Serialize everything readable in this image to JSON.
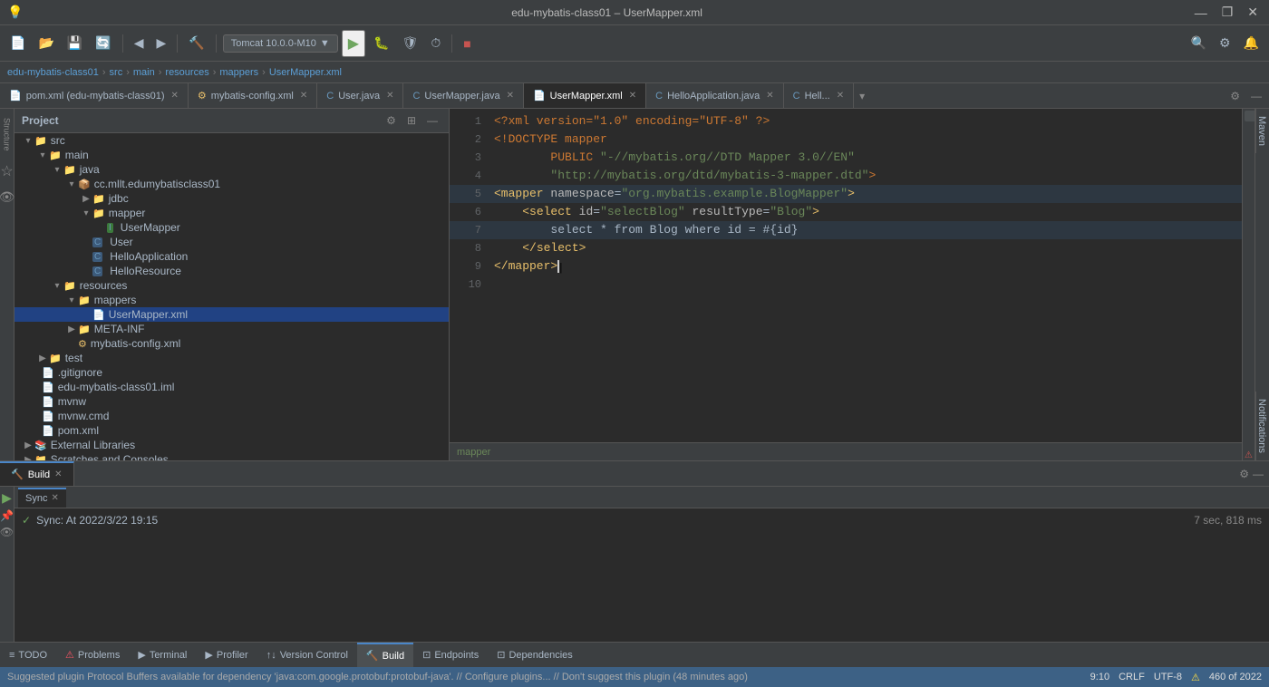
{
  "titleBar": {
    "title": "edu-mybatis-class01 – UserMapper.xml",
    "minimizeBtn": "—",
    "maximizeBtn": "❐",
    "closeBtn": "✕"
  },
  "toolbar": {
    "runConfig": "Tomcat 10.0.0-M10"
  },
  "navBar": {
    "items": [
      "edu-mybatis-class01",
      "src",
      "main",
      "resources",
      "mappers",
      "UserMapper.xml"
    ]
  },
  "tabs": [
    {
      "label": "pom.xml",
      "sublabel": "(edu-mybatis-class01)",
      "active": false,
      "icon": "📄"
    },
    {
      "label": "mybatis-config.xml",
      "active": false,
      "icon": "⚙️"
    },
    {
      "label": "User.java",
      "active": false,
      "icon": "☕"
    },
    {
      "label": "UserMapper.java",
      "active": false,
      "icon": "☕"
    },
    {
      "label": "UserMapper.xml",
      "active": true,
      "icon": "📄"
    },
    {
      "label": "HelloApplication.java",
      "active": false,
      "icon": "☕"
    },
    {
      "label": "Hell...",
      "active": false,
      "icon": "☕"
    }
  ],
  "editor": {
    "lines": [
      {
        "num": 1,
        "content": "<?xml version=\"1.0\" encoding=\"UTF-8\" ?>",
        "type": "decl"
      },
      {
        "num": 2,
        "content": "<!DOCTYPE mapper",
        "type": "doctype"
      },
      {
        "num": 3,
        "content": "        PUBLIC \"-//mybatis.org//DTD Mapper 3.0//EN\"",
        "type": "string"
      },
      {
        "num": 4,
        "content": "        \"http://mybatis.org/dtd/mybatis-3-mapper.dtd\">",
        "type": "string"
      },
      {
        "num": 5,
        "content": "<mapper namespace=\"org.mybatis.example.BlogMapper\">",
        "type": "tag",
        "highlighted": true
      },
      {
        "num": 6,
        "content": "    <select id=\"selectBlog\" resultType=\"Blog\">",
        "type": "tag"
      },
      {
        "num": 7,
        "content": "        select * from Blog where id = #{id}",
        "type": "mixed",
        "cursor": true
      },
      {
        "num": 8,
        "content": "    </select>",
        "type": "tag"
      },
      {
        "num": 9,
        "content": "</mapper>",
        "type": "tag",
        "cursor_end": true
      },
      {
        "num": 10,
        "content": "",
        "type": "empty"
      }
    ],
    "statusTag": "mapper"
  },
  "projectTree": {
    "title": "Project",
    "items": [
      {
        "label": "src",
        "type": "folder",
        "level": 1,
        "expanded": true
      },
      {
        "label": "main",
        "type": "folder",
        "level": 2,
        "expanded": true
      },
      {
        "label": "java",
        "type": "folder",
        "level": 3,
        "expanded": true
      },
      {
        "label": "cc.mllt.edumybatisclass01",
        "type": "package",
        "level": 4,
        "expanded": true
      },
      {
        "label": "jdbc",
        "type": "folder",
        "level": 5,
        "expanded": false
      },
      {
        "label": "mapper",
        "type": "folder",
        "level": 5,
        "expanded": true
      },
      {
        "label": "UserMapper",
        "type": "interface",
        "level": 6
      },
      {
        "label": "User",
        "type": "class",
        "level": 5
      },
      {
        "label": "HelloApplication",
        "type": "class",
        "level": 5
      },
      {
        "label": "HelloResource",
        "type": "class",
        "level": 5
      },
      {
        "label": "resources",
        "type": "folder",
        "level": 3,
        "expanded": true
      },
      {
        "label": "mappers",
        "type": "folder",
        "level": 4,
        "expanded": true
      },
      {
        "label": "UserMapper.xml",
        "type": "xml",
        "level": 5,
        "selected": true
      },
      {
        "label": "META-INF",
        "type": "folder",
        "level": 4,
        "expanded": false
      },
      {
        "label": "mybatis-config.xml",
        "type": "xml",
        "level": 4
      },
      {
        "label": "test",
        "type": "folder",
        "level": 2,
        "expanded": false
      },
      {
        "label": ".gitignore",
        "type": "file",
        "level": 1
      },
      {
        "label": "edu-mybatis-class01.iml",
        "type": "iml",
        "level": 1
      },
      {
        "label": "mvnw",
        "type": "file",
        "level": 1
      },
      {
        "label": "mvnw.cmd",
        "type": "file",
        "level": 1
      },
      {
        "label": "pom.xml",
        "type": "xml",
        "level": 1
      },
      {
        "label": "External Libraries",
        "type": "folder",
        "level": 1,
        "expanded": false
      },
      {
        "label": "Scratches and Consoles",
        "type": "folder",
        "level": 1,
        "expanded": false
      }
    ]
  },
  "bottomPanel": {
    "tabs": [
      {
        "label": "Build",
        "active": true,
        "closeable": true
      },
      {
        "icon": "≡",
        "label": "TODO"
      },
      {
        "icon": "⚠",
        "label": "Problems"
      },
      {
        "icon": "▶",
        "label": "Terminal"
      },
      {
        "icon": "▶",
        "label": "Profiler"
      },
      {
        "icon": "↑↓",
        "label": "Version Control"
      },
      {
        "icon": "🔨",
        "label": "Build"
      },
      {
        "icon": "⊡",
        "label": "Endpoints"
      },
      {
        "icon": "⊡",
        "label": "Dependencies"
      }
    ],
    "buildResult": {
      "icon": "✓",
      "text": "Sync: At 2022/3/22 19:15",
      "time": "7 sec, 818 ms"
    },
    "syncLabel": "Sync"
  },
  "statusBar": {
    "position": "9:10",
    "lineEnding": "CRLF",
    "encoding": "UTF-8",
    "warningIcon": "⚠",
    "location": "460 of 2022",
    "pluginMsg": "Suggested plugin Protocol Buffers available for dependency 'java:com.google.protobuf:protobuf-java'. // Configure plugins... // Don't suggest this plugin (48 minutes ago)"
  }
}
